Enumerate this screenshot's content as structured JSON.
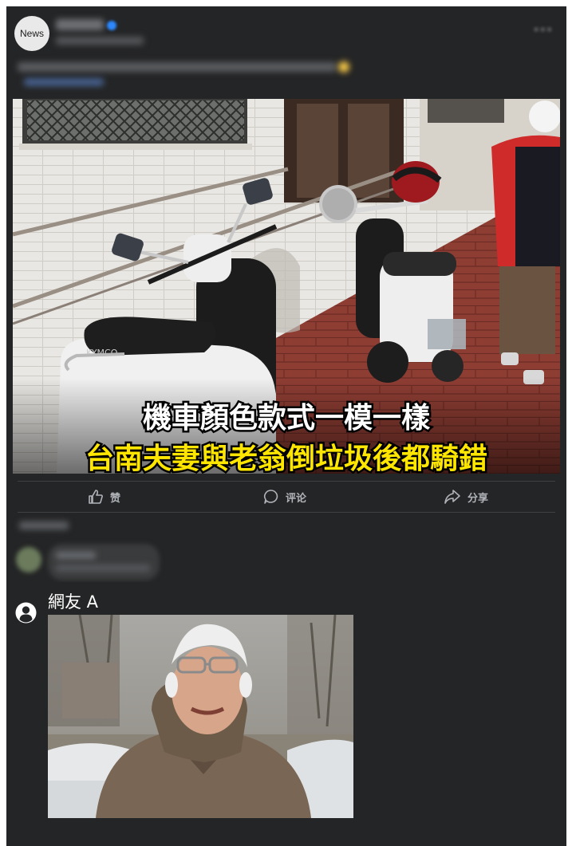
{
  "post": {
    "page_avatar_text": "News",
    "page_name": "",
    "post_time": "",
    "text_line1": "",
    "text_line2": "",
    "image": {
      "caption_line1": "機車顏色款式一模一樣",
      "caption_line2": "台南夫妻與老翁倒垃圾後都騎錯",
      "caption_line1_color": "#ffffff",
      "caption_line2_color": "#ffe600",
      "scooter_brand": "KYMCO"
    },
    "actions": {
      "like_label": "赞",
      "comment_label": "评论",
      "share_label": "分享"
    }
  },
  "comments": {
    "sort_label": "",
    "first_comment_blurred": true,
    "reply": {
      "username": "網友 A",
      "image_icon": "photo"
    }
  },
  "theme": {
    "card_bg": "#242526",
    "divider": "#3e4042",
    "text_secondary": "#b0b3b8"
  }
}
